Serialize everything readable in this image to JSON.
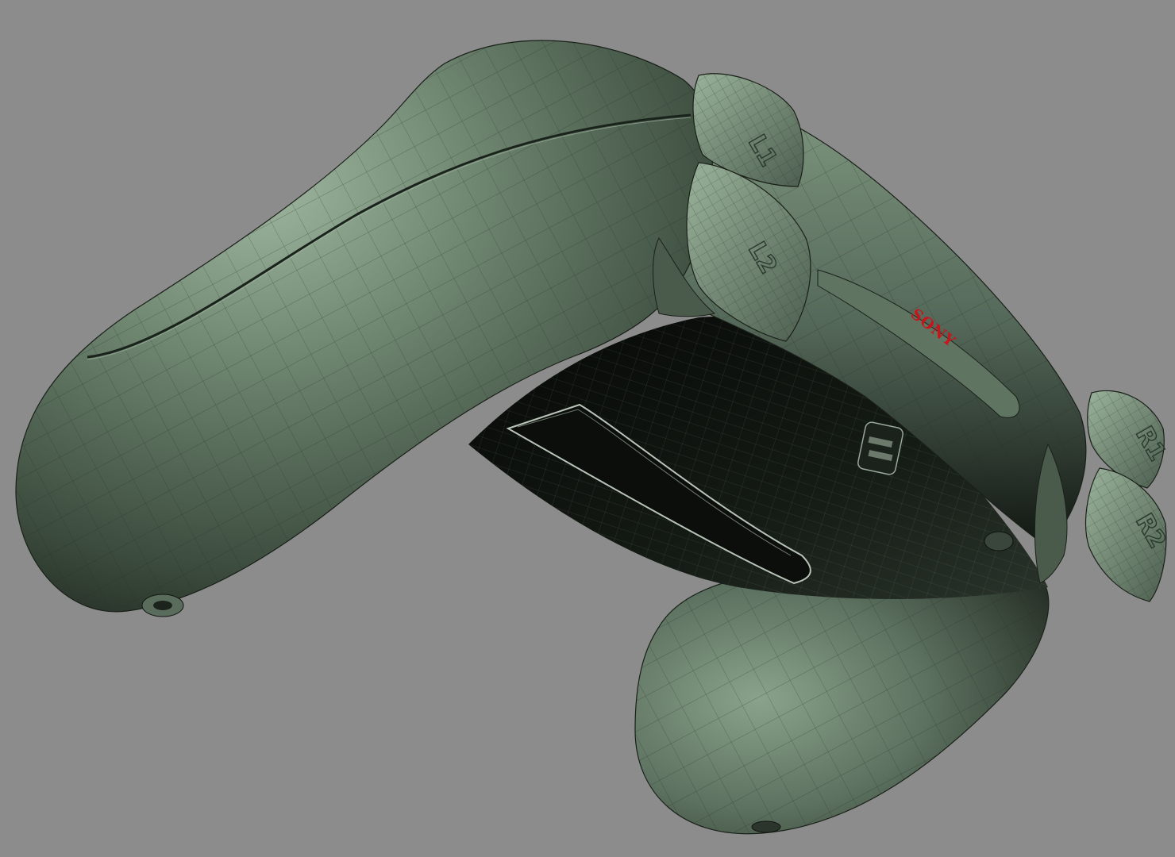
{
  "scene": {
    "subject": "game-controller-wireframe-model",
    "background_color": "#8c8c8c",
    "shell_color": "#6e8570",
    "shell_highlight": "#9fb7a0",
    "shell_shadow": "#1a2019",
    "wire_color": "#1e2a20",
    "logo_color": "#c8141a"
  },
  "labels": {
    "logo": "SONY",
    "left_bumper": "L1",
    "left_trigger": "L2",
    "right_bumper": "R1",
    "right_trigger": "R2"
  }
}
